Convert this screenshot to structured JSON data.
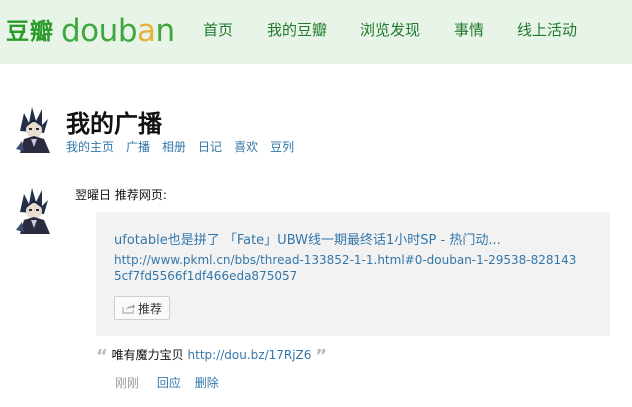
{
  "brand": {
    "cn": "豆瓣",
    "en_parts": [
      "do",
      "u",
      "b",
      "a",
      "n"
    ]
  },
  "nav": {
    "items": [
      "首页",
      "我的豆瓣",
      "浏览发现",
      "事情",
      "线上活动"
    ]
  },
  "profile": {
    "title": "我的广播",
    "subnav": [
      "我的主页",
      "广播",
      "相册",
      "日记",
      "喜欢",
      "豆列"
    ]
  },
  "status": {
    "user": "翌曜日",
    "verb": "推荐网页:",
    "card": {
      "title": "ufotable也是拼了 「Fate」UBW线一期最终话1小时SP - 热门动...",
      "url": "http://www.pkml.cn/bbs/thread-133852-1-1.html#0-douban-1-29538-8281435cf7fd5566f1df466eda875057",
      "button": "推荐"
    },
    "comment": {
      "text": "唯有魔力宝贝",
      "link": "http://dou.bz/17RjZ6"
    },
    "time": "刚刚",
    "actions": [
      "回应",
      "删除"
    ]
  },
  "colors": {
    "topbar_bg": "#e9f4e9",
    "link": "#3377aa",
    "nav_text": "#1f7a2a",
    "logo_green": "#2a9b2a",
    "card_bg": "#f2f2f2"
  },
  "icons": [
    "share-icon",
    "open-quote-icon",
    "close-quote-icon",
    "avatar"
  ]
}
